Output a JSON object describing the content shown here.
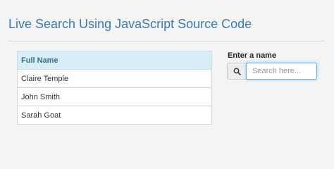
{
  "page": {
    "title": "Live Search Using JavaScript Source Code"
  },
  "table": {
    "header": "Full Name",
    "rows": [
      "Claire Temple",
      "John Smith",
      "Sarah Goat"
    ]
  },
  "search": {
    "label": "Enter a name",
    "placeholder": "Search here...",
    "value": "",
    "icon": "search-icon"
  },
  "colors": {
    "title": "#3a7ab8",
    "header_bg": "#d9edf7",
    "header_text": "#31708f",
    "focus_border": "#66afe9",
    "background": "#f4f4f4"
  }
}
